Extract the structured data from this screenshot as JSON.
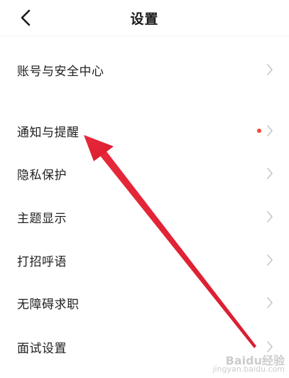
{
  "header": {
    "title": "设置",
    "back_icon": "chevron-left-icon"
  },
  "settings": {
    "items": [
      {
        "label": "账号与安全中心",
        "badge": false
      },
      {
        "label": "通知与提醒",
        "badge": true
      },
      {
        "label": "隐私保护",
        "badge": false
      },
      {
        "label": "主题显示",
        "badge": false
      },
      {
        "label": "打招呼语",
        "badge": false
      },
      {
        "label": "无障碍求职",
        "badge": false
      },
      {
        "label": "面试设置",
        "badge": false
      }
    ]
  },
  "annotation": {
    "arrow_color": "#e8283a"
  },
  "watermark": {
    "main": "Baidu经验",
    "sub": "jingyan.baidu.com"
  },
  "colors": {
    "badge_dot": "#f5483b",
    "chevron": "#c7c7c7",
    "text": "#1f1f1f"
  }
}
